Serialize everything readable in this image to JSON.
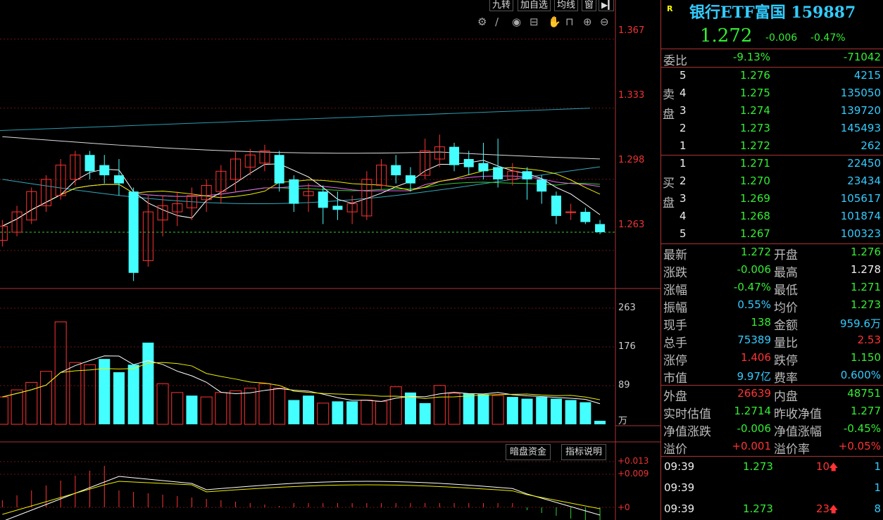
{
  "toolbar": {
    "items": [
      "九转",
      "加自选",
      "均线",
      "窗"
    ]
  },
  "price_axis": [
    "1.367",
    "1.333",
    "1.298",
    "1.263"
  ],
  "vol_axis": [
    "263",
    "176",
    "89",
    "万"
  ],
  "ind_axis": [
    "+0.013",
    "+0.009",
    "+0"
  ],
  "buttons": {
    "dark_fund": "暗盘资金",
    "indicator_help": "指标说明"
  },
  "header": {
    "tag": "R",
    "title": "银行ETF富国 159887",
    "price": "1.272",
    "change": "-0.006",
    "pct": "-0.47%"
  },
  "weibi": {
    "label": "委比",
    "pct": "-9.13%",
    "diff": "-71042"
  },
  "sell_label": [
    "卖",
    "盘"
  ],
  "buy_label": [
    "买",
    "盘"
  ],
  "sell": [
    {
      "lvl": "5",
      "price": "1.276",
      "vol": "4215"
    },
    {
      "lvl": "4",
      "price": "1.275",
      "vol": "135050"
    },
    {
      "lvl": "3",
      "price": "1.274",
      "vol": "139720"
    },
    {
      "lvl": "2",
      "price": "1.273",
      "vol": "145493"
    },
    {
      "lvl": "1",
      "price": "1.272",
      "vol": "262"
    }
  ],
  "buy": [
    {
      "lvl": "1",
      "price": "1.271",
      "vol": "22450"
    },
    {
      "lvl": "2",
      "price": "1.270",
      "vol": "23434"
    },
    {
      "lvl": "3",
      "price": "1.269",
      "vol": "105617"
    },
    {
      "lvl": "4",
      "price": "1.268",
      "vol": "101874"
    },
    {
      "lvl": "5",
      "price": "1.267",
      "vol": "100323"
    }
  ],
  "stats": [
    {
      "l1": "最新",
      "v1": "1.272",
      "c1": "g",
      "l2": "开盘",
      "v2": "1.276",
      "c2": "g"
    },
    {
      "l1": "涨跌",
      "v1": "-0.006",
      "c1": "g",
      "l2": "最高",
      "v2": "1.278",
      "c2": "w"
    },
    {
      "l1": "涨幅",
      "v1": "-0.47%",
      "c1": "g",
      "l2": "最低",
      "v2": "1.271",
      "c2": "g"
    },
    {
      "l1": "振幅",
      "v1": "0.55%",
      "c1": "c",
      "l2": "均价",
      "v2": "1.273",
      "c2": "g"
    },
    {
      "l1": "现手",
      "v1": "138",
      "c1": "g",
      "l2": "金额",
      "v2": "959.6万",
      "c2": "c"
    },
    {
      "l1": "总手",
      "v1": "75389",
      "c1": "c",
      "l2": "量比",
      "v2": "2.53",
      "c2": "r"
    },
    {
      "l1": "涨停",
      "v1": "1.406",
      "c1": "r",
      "l2": "跌停",
      "v2": "1.150",
      "c2": "g"
    },
    {
      "l1": "市值",
      "v1": "9.97亿",
      "c1": "c",
      "l2": "费率",
      "v2": "0.600%",
      "c2": "c"
    }
  ],
  "stats2": [
    {
      "l1": "外盘",
      "v1": "26639",
      "c1": "r",
      "l2": "内盘",
      "v2": "48751",
      "c2": "g"
    },
    {
      "l1": "实时估值",
      "v1": "1.2714",
      "c1": "g",
      "l2": "昨收净值",
      "v2": "1.277",
      "c2": "g"
    },
    {
      "l1": "净值涨跌",
      "v1": "-0.006",
      "c1": "g",
      "l2": "净值涨幅",
      "v2": "-0.45%",
      "c2": "g"
    },
    {
      "l1": "溢价",
      "v1": "+0.001",
      "c1": "r",
      "l2": "溢价率",
      "v2": "+0.05%",
      "c2": "r"
    }
  ],
  "ticks": [
    {
      "time": "09:39",
      "price": "1.273",
      "vol": "10",
      "arrow": "up",
      "n": "1"
    },
    {
      "time": "09:39",
      "price": "",
      "vol": "",
      "arrow": "",
      "n": "1"
    },
    {
      "time": "09:39",
      "price": "1.273",
      "vol": "23",
      "arrow": "up",
      "n": "8"
    }
  ],
  "chart_data": {
    "type": "candlestick",
    "ylim": [
      1.245,
      1.38
    ],
    "last_price": 1.272,
    "candles": [
      [
        1.268,
        1.275,
        1.265,
        1.278
      ],
      [
        1.272,
        1.282,
        1.27,
        1.285
      ],
      [
        1.278,
        1.292,
        1.276,
        1.294
      ],
      [
        1.285,
        1.298,
        1.282,
        1.3
      ],
      [
        1.29,
        1.305,
        1.288,
        1.308
      ],
      [
        1.298,
        1.31,
        1.295,
        1.312
      ],
      [
        1.31,
        1.302,
        1.298,
        1.312
      ],
      [
        1.305,
        1.3,
        1.296,
        1.31
      ],
      [
        1.3,
        1.296,
        1.29,
        1.308
      ],
      [
        1.292,
        1.252,
        1.248,
        1.294
      ],
      [
        1.258,
        1.282,
        1.255,
        1.29
      ],
      [
        1.278,
        1.285,
        1.27,
        1.29
      ],
      [
        1.282,
        1.286,
        1.275,
        1.292
      ],
      [
        1.284,
        1.29,
        1.278,
        1.294
      ],
      [
        1.288,
        1.295,
        1.282,
        1.298
      ],
      [
        1.292,
        1.302,
        1.286,
        1.305
      ],
      [
        1.298,
        1.308,
        1.292,
        1.312
      ],
      [
        1.304,
        1.31,
        1.3,
        1.313
      ],
      [
        1.306,
        1.312,
        1.302,
        1.315
      ],
      [
        1.31,
        1.296,
        1.292,
        1.312
      ],
      [
        1.298,
        1.286,
        1.282,
        1.3
      ],
      [
        1.29,
        1.292,
        1.282,
        1.296
      ],
      [
        1.292,
        1.284,
        1.276,
        1.295
      ],
      [
        1.285,
        1.283,
        1.278,
        1.292
      ],
      [
        1.282,
        1.286,
        1.276,
        1.29
      ],
      [
        1.28,
        1.298,
        1.278,
        1.302
      ],
      [
        1.295,
        1.305,
        1.293,
        1.308
      ],
      [
        1.305,
        1.3,
        1.296,
        1.31
      ],
      [
        1.3,
        1.296,
        1.292,
        1.304
      ],
      [
        1.3,
        1.312,
        1.298,
        1.318
      ],
      [
        1.308,
        1.314,
        1.304,
        1.32
      ],
      [
        1.314,
        1.305,
        1.302,
        1.316
      ],
      [
        1.308,
        1.304,
        1.3,
        1.312
      ],
      [
        1.306,
        1.302,
        1.298,
        1.316
      ],
      [
        1.304,
        1.298,
        1.294,
        1.318
      ],
      [
        1.298,
        1.302,
        1.295,
        1.306
      ],
      [
        1.302,
        1.298,
        1.288,
        1.304
      ],
      [
        1.298,
        1.292,
        1.286,
        1.3
      ],
      [
        1.29,
        1.28,
        1.276,
        1.292
      ],
      [
        1.282,
        1.282,
        1.278,
        1.286
      ],
      [
        1.282,
        1.277,
        1.276,
        1.284
      ],
      [
        1.276,
        1.272,
        1.271,
        1.278
      ]
    ],
    "volumes": [
      [
        62,
        1
      ],
      [
        78,
        1
      ],
      [
        95,
        1
      ],
      [
        120,
        1
      ],
      [
        232,
        1
      ],
      [
        140,
        1
      ],
      [
        135,
        1
      ],
      [
        148,
        -1
      ],
      [
        118,
        -1
      ],
      [
        135,
        -1
      ],
      [
        185,
        -1
      ],
      [
        92,
        1
      ],
      [
        72,
        1
      ],
      [
        65,
        -1
      ],
      [
        62,
        1
      ],
      [
        72,
        1
      ],
      [
        76,
        1
      ],
      [
        82,
        1
      ],
      [
        92,
        1
      ],
      [
        82,
        1
      ],
      [
        55,
        -1
      ],
      [
        65,
        -1
      ],
      [
        48,
        1
      ],
      [
        52,
        -1
      ],
      [
        52,
        -1
      ],
      [
        55,
        1
      ],
      [
        52,
        1
      ],
      [
        85,
        1
      ],
      [
        72,
        -1
      ],
      [
        48,
        -1
      ],
      [
        88,
        1
      ],
      [
        70,
        1
      ],
      [
        70,
        -1
      ],
      [
        68,
        -1
      ],
      [
        65,
        1
      ],
      [
        62,
        -1
      ],
      [
        58,
        -1
      ],
      [
        62,
        -1
      ],
      [
        58,
        -1
      ],
      [
        55,
        -1
      ],
      [
        50,
        -1
      ],
      [
        8,
        -1
      ]
    ]
  }
}
